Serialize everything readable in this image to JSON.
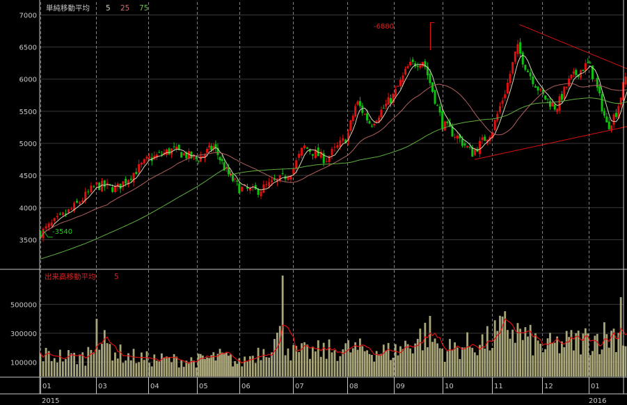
{
  "price_legend": {
    "title": "単純移動平均",
    "p1": "5",
    "p2": "25",
    "p3": "75"
  },
  "volume_legend": {
    "title": "出来高移動平均",
    "p1": "5"
  },
  "annotations": {
    "high": "-6880",
    "low": "-3540"
  },
  "colors": {
    "background": "#000000",
    "up": "#e01010",
    "down": "#10c010",
    "ma5": "#d8d8b8",
    "ma25": "#b06060",
    "ma75": "#60b040",
    "volume_bar": "#a9a67a",
    "volume_ma": "#e01010",
    "trendline": "#e01010",
    "grid": "#808080"
  },
  "chart_data": [
    {
      "type": "candlestick",
      "title": "単純移動平均",
      "y_ticks": [
        7000,
        6500,
        6000,
        5500,
        5000,
        4500,
        4000,
        3500
      ],
      "ylim": [
        3050,
        7200
      ],
      "x_ticks": [
        "01",
        "03",
        "04",
        "05",
        "06",
        "07",
        "08",
        "09",
        "10",
        "11",
        "12",
        "01"
      ],
      "year_labels": [
        "2015",
        "2016"
      ],
      "moving_averages": [
        "5",
        "25",
        "75"
      ],
      "high_marker": 6880,
      "low_marker": 3540,
      "keypoints": [
        {
          "month_index": 0.0,
          "close": 3600
        },
        {
          "month_index": 0.6,
          "close": 4000
        },
        {
          "month_index": 1.0,
          "close": 4350
        },
        {
          "month_index": 1.4,
          "close": 4300
        },
        {
          "month_index": 2.0,
          "close": 4750
        },
        {
          "month_index": 2.5,
          "close": 4900
        },
        {
          "month_index": 3.0,
          "close": 4750
        },
        {
          "month_index": 3.4,
          "close": 4950
        },
        {
          "month_index": 3.7,
          "close": 4550
        },
        {
          "month_index": 4.0,
          "close": 4300
        },
        {
          "month_index": 4.3,
          "close": 4250
        },
        {
          "month_index": 4.8,
          "close": 4450
        },
        {
          "month_index": 5.0,
          "close": 4600
        },
        {
          "month_index": 5.2,
          "close": 4950
        },
        {
          "month_index": 5.6,
          "close": 4750
        },
        {
          "month_index": 6.0,
          "close": 5100
        },
        {
          "month_index": 6.2,
          "close": 5650
        },
        {
          "month_index": 6.5,
          "close": 5300
        },
        {
          "month_index": 7.0,
          "close": 5750
        },
        {
          "month_index": 7.3,
          "close": 6200
        },
        {
          "month_index": 7.6,
          "close": 6300
        },
        {
          "month_index": 8.0,
          "close": 5300
        },
        {
          "month_index": 8.3,
          "close": 5100
        },
        {
          "month_index": 8.6,
          "close": 4850
        },
        {
          "month_index": 9.0,
          "close": 5200
        },
        {
          "month_index": 9.3,
          "close": 5900
        },
        {
          "month_index": 9.5,
          "close": 6500
        },
        {
          "month_index": 9.7,
          "close": 6150
        },
        {
          "month_index": 10.0,
          "close": 5750
        },
        {
          "month_index": 10.3,
          "close": 5550
        },
        {
          "month_index": 10.6,
          "close": 6000
        },
        {
          "month_index": 11.0,
          "close": 6250
        },
        {
          "month_index": 11.2,
          "close": 5800
        },
        {
          "month_index": 11.4,
          "close": 5250
        },
        {
          "month_index": 11.6,
          "close": 5500
        },
        {
          "month_index": 11.8,
          "close": 6050
        },
        {
          "month_index": 12.0,
          "close": 5650
        },
        {
          "month_index": 12.3,
          "close": 5550
        },
        {
          "month_index": 12.6,
          "close": 5450
        }
      ],
      "trendlines": [
        {
          "from": {
            "month_index": 9.55,
            "value": 6850
          },
          "to": {
            "month_index": 12.7,
            "value": 5900
          }
        },
        {
          "from": {
            "month_index": 8.65,
            "value": 4750
          },
          "to": {
            "month_index": 12.7,
            "value": 5400
          }
        }
      ]
    },
    {
      "type": "bar",
      "title": "出来高移動平均",
      "y_ticks": [
        500000,
        300000,
        100000
      ],
      "ylim": [
        0,
        700000
      ],
      "moving_average": "5",
      "keypoints": [
        {
          "month_index": 0.0,
          "value": 150000
        },
        {
          "month_index": 0.8,
          "value": 130000
        },
        {
          "month_index": 1.0,
          "value": 260000
        },
        {
          "month_index": 1.5,
          "value": 150000
        },
        {
          "month_index": 2.0,
          "value": 120000
        },
        {
          "month_index": 3.0,
          "value": 110000
        },
        {
          "month_index": 3.6,
          "value": 140000
        },
        {
          "month_index": 4.0,
          "value": 90000
        },
        {
          "month_index": 4.8,
          "value": 280000
        },
        {
          "month_index": 5.0,
          "value": 160000
        },
        {
          "month_index": 6.0,
          "value": 190000
        },
        {
          "month_index": 7.0,
          "value": 170000
        },
        {
          "month_index": 7.7,
          "value": 300000
        },
        {
          "month_index": 8.0,
          "value": 180000
        },
        {
          "month_index": 9.0,
          "value": 250000
        },
        {
          "month_index": 9.3,
          "value": 350000
        },
        {
          "month_index": 10.0,
          "value": 200000
        },
        {
          "month_index": 11.0,
          "value": 260000
        },
        {
          "month_index": 11.6,
          "value": 300000
        },
        {
          "month_index": 12.0,
          "value": 170000
        },
        {
          "month_index": 12.6,
          "value": 200000
        }
      ],
      "spikes": [
        {
          "month_index": 1.0,
          "value": 400000
        },
        {
          "month_index": 4.8,
          "value": 700000
        },
        {
          "month_index": 7.75,
          "value": 420000
        },
        {
          "month_index": 9.05,
          "value": 390000
        },
        {
          "month_index": 11.7,
          "value": 550000
        }
      ]
    }
  ]
}
